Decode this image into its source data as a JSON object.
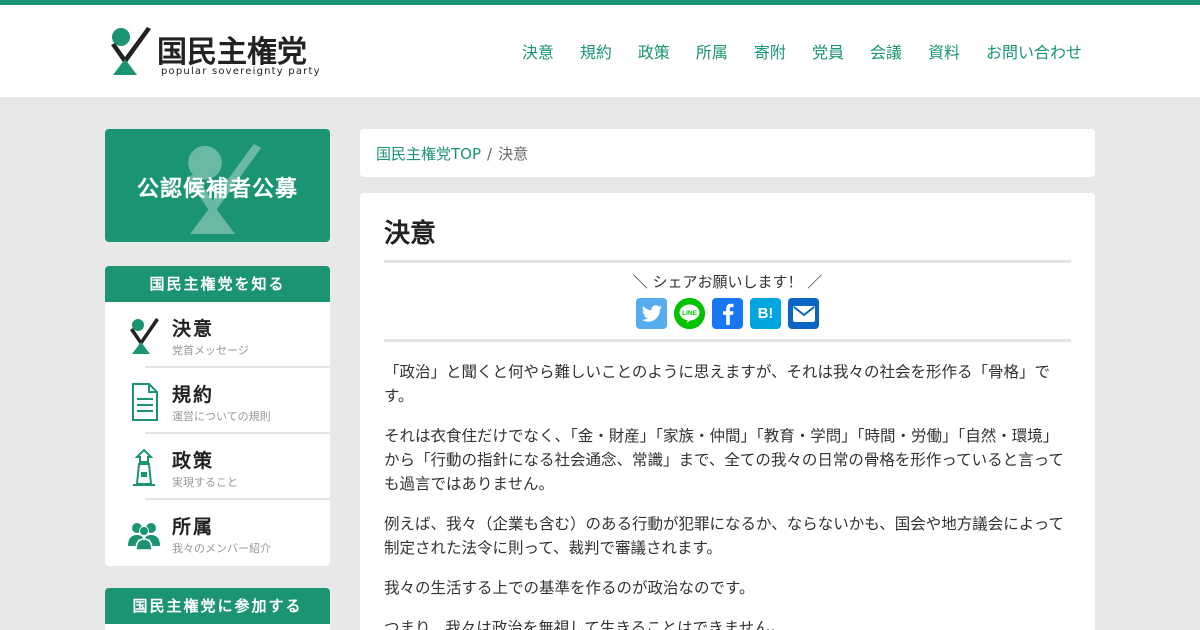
{
  "brand": {
    "title": "国民主権党",
    "subtitle": "popular sovereignty party",
    "color": "#1a9473"
  },
  "nav": [
    {
      "label": "決意"
    },
    {
      "label": "規約"
    },
    {
      "label": "政策"
    },
    {
      "label": "所属"
    },
    {
      "label": "寄附"
    },
    {
      "label": "党員"
    },
    {
      "label": "会議"
    },
    {
      "label": "資料"
    },
    {
      "label": "お問い合わせ"
    }
  ],
  "banner": {
    "text": "公認候補者公募"
  },
  "sidebar_know": {
    "heading": "国民主権党を知る",
    "items": [
      {
        "title": "決意",
        "sub": "党首メッセージ",
        "icon": "party-logo-icon"
      },
      {
        "title": "規約",
        "sub": "運営についての規則",
        "icon": "document-icon"
      },
      {
        "title": "政策",
        "sub": "実現すること",
        "icon": "lighthouse-icon"
      },
      {
        "title": "所属",
        "sub": "我々のメンバー紹介",
        "icon": "people-icon"
      }
    ]
  },
  "sidebar_join": {
    "heading": "国民主権党に参加する"
  },
  "breadcrumb": {
    "home": "国民主権党TOP",
    "separator": "/",
    "current": "決意"
  },
  "article": {
    "title": "決意",
    "share_text": "＼ シェアお願いします！ ／",
    "share_buttons": [
      {
        "name": "twitter-icon",
        "color": "#55acee",
        "glyph": "🐦"
      },
      {
        "name": "line-icon",
        "color": "#00c300",
        "glyph": "LINE"
      },
      {
        "name": "facebook-icon",
        "color": "#1877f2",
        "glyph": "f"
      },
      {
        "name": "hatena-icon",
        "color": "#00a4de",
        "glyph": "B!"
      },
      {
        "name": "email-icon",
        "color": "#0a66c2",
        "glyph": "✉"
      }
    ],
    "paragraphs": [
      "「政治」と聞くと何やら難しいことのように思えますが、それは我々の社会を形作る「骨格」です。",
      "それは衣食住だけでなく、「金・財産」「家族・仲間」「教育・学問」「時間・労働」「自然・環境」から「行動の指針になる社会通念、常識」まで、全ての我々の日常の骨格を形作っていると言っても過言ではありません。",
      "例えば、我々（企業も含む）のある行動が犯罪になるか、ならないかも、国会や地方議会によって制定された法令に則って、裁判で審議されます。",
      "我々の生活する上での基準を作るのが政治なのです。",
      "つまり、我々は政治を無視して生きることはできません。"
    ]
  }
}
